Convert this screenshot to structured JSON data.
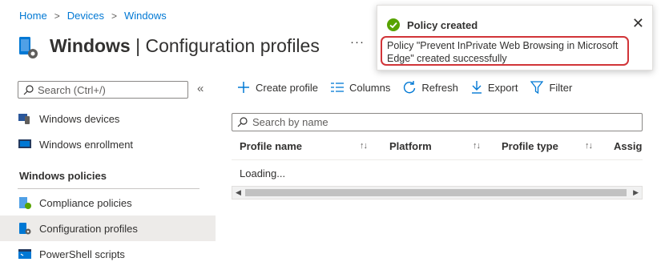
{
  "breadcrumb": [
    "Home",
    "Devices",
    "Windows"
  ],
  "page": {
    "title_bold": "Windows",
    "title_rest": " | Configuration profiles",
    "more": "···"
  },
  "nav": {
    "search_placeholder": "Search (Ctrl+/)",
    "collapse": "«",
    "items": [
      {
        "label": "Windows devices",
        "icon": "windows-devices-icon"
      },
      {
        "label": "Windows enrollment",
        "icon": "windows-enrollment-icon"
      }
    ],
    "section": "Windows policies",
    "policy_items": [
      {
        "label": "Compliance policies",
        "icon": "compliance-icon"
      },
      {
        "label": "Configuration profiles",
        "icon": "config-profile-icon",
        "active": true
      },
      {
        "label": "PowerShell scripts",
        "icon": "powershell-icon"
      }
    ]
  },
  "toolbar": {
    "create": "Create profile",
    "columns": "Columns",
    "refresh": "Refresh",
    "export": "Export",
    "filter": "Filter"
  },
  "grid": {
    "search_placeholder": "Search by name",
    "columns": [
      "Profile name",
      "Platform",
      "Profile type",
      "Assign"
    ],
    "status": "Loading..."
  },
  "toast": {
    "title": "Policy created",
    "message": "Policy \"Prevent InPrivate Web Browsing in Microsoft Edge\" created successfully",
    "close": "✕"
  },
  "colors": {
    "accent": "#0078d4",
    "success": "#57a300",
    "highlight": "#d13438"
  }
}
